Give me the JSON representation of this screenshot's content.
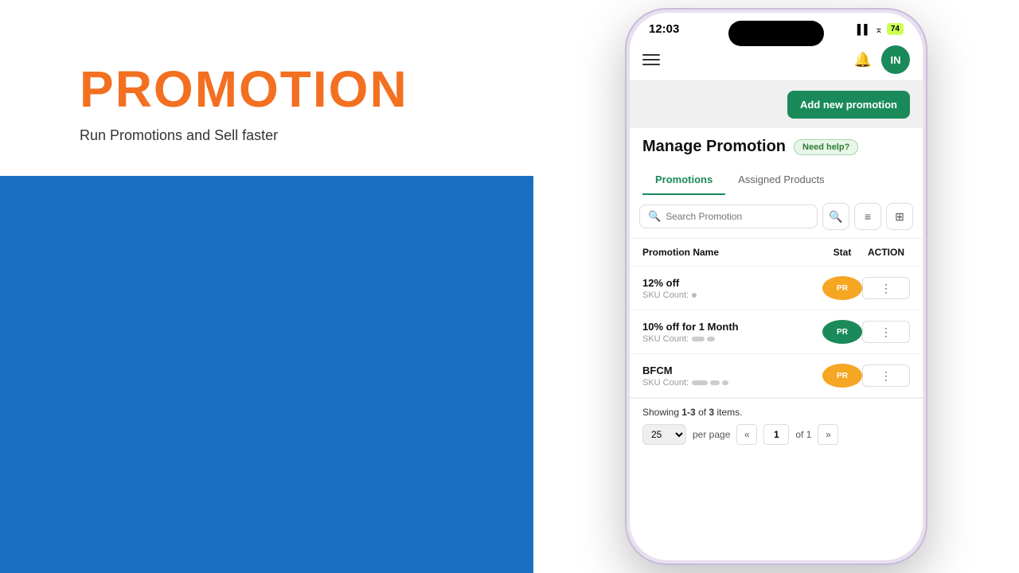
{
  "left": {
    "title": "PROMOTION",
    "subtitle": "Run Promotions and Sell faster"
  },
  "phone": {
    "status": {
      "time": "12:03",
      "battery": "74",
      "icons": "▌▌ ⌅"
    },
    "nav": {
      "avatar_initials": "IN"
    },
    "header": {
      "add_button_label": "Add new promotion",
      "manage_title": "Manage Promotion",
      "need_help_label": "Need help?"
    },
    "tabs": [
      {
        "label": "Promotions",
        "active": true
      },
      {
        "label": "Assigned Products",
        "active": false
      }
    ],
    "search": {
      "placeholder": "Search Promotion"
    },
    "table": {
      "columns": {
        "name": "Promotion Name",
        "status": "Stat",
        "action": "ACTION"
      },
      "rows": [
        {
          "name": "12% off",
          "sku_label": "SKU Count:",
          "status_badge": "PR",
          "status_color": "orange"
        },
        {
          "name": "10% off for 1 Month",
          "sku_label": "SKU Count:",
          "status_badge": "PR",
          "status_color": "green"
        },
        {
          "name": "BFCM",
          "sku_label": "SKU Count:",
          "status_badge": "PR",
          "status_color": "orange"
        }
      ]
    },
    "pagination": {
      "showing_text": "Showing ",
      "range": "1-3",
      "of_label": "of",
      "total": "3",
      "items_label": "items.",
      "per_page": "25",
      "per_page_label": "per page",
      "page_current": "1",
      "page_of": "of 1"
    }
  }
}
